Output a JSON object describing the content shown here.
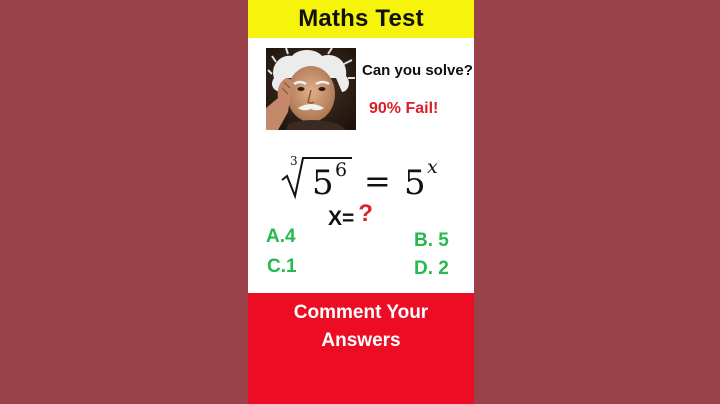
{
  "header": {
    "title": "Maths Test"
  },
  "teaser": {
    "question": "Can you solve?",
    "fail_text": "90% Fail!"
  },
  "equation": {
    "root_index": "3",
    "base": "5",
    "power": "6",
    "equals": "=",
    "rhs_base": "5",
    "rhs_exponent": "x"
  },
  "prompt": {
    "label": "X=",
    "mark": "?"
  },
  "options": {
    "a": "A.4",
    "b": "B. 5",
    "c": "C.1",
    "d": "D. 2"
  },
  "cta": {
    "line1": "Comment Your",
    "line2": "Answers"
  },
  "colors": {
    "page_background": "#9b4149",
    "banner": "#f6f40a",
    "fail_text": "#d8202a",
    "options": "#27b84e",
    "cta_background": "#ec0c23"
  },
  "image": {
    "portrait": "elderly-scientist-portrait"
  }
}
